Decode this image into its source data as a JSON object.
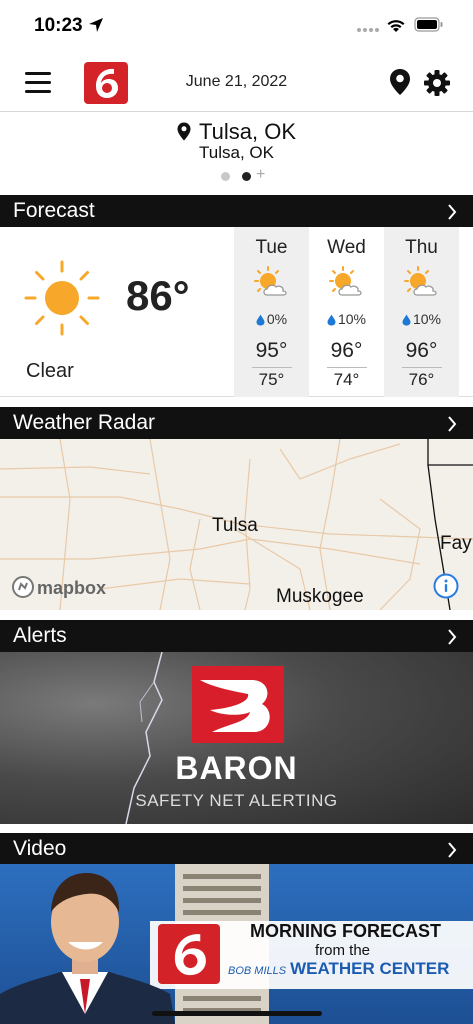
{
  "status_bar": {
    "time": "10:23"
  },
  "header": {
    "date": "June 21, 2022"
  },
  "location": {
    "city": "Tulsa, OK",
    "subtitle": "Tulsa, OK"
  },
  "sections": {
    "forecast": "Forecast",
    "radar": "Weather Radar",
    "alerts": "Alerts",
    "video": "Video"
  },
  "current": {
    "temp": "86°",
    "condition": "Clear",
    "icon": "sun-icon"
  },
  "days": [
    {
      "name": "Tue",
      "precip": "0%",
      "high": "95°",
      "low": "75°",
      "icon": "partly-cloudy-icon"
    },
    {
      "name": "Wed",
      "precip": "10%",
      "high": "96°",
      "low": "74°",
      "icon": "partly-cloudy-icon"
    },
    {
      "name": "Thu",
      "precip": "10%",
      "high": "96°",
      "low": "76°",
      "icon": "partly-cloudy-icon"
    }
  ],
  "radar": {
    "cities": [
      "Tulsa",
      "Muskogee",
      "Fay"
    ],
    "attribution": "mapbox"
  },
  "alerts": {
    "brand": "BARON",
    "tagline": "SAFETY NET ALERTING"
  },
  "video": {
    "line1": "MORNING FORECAST",
    "line2": "from the",
    "line3_small": "BOB MILLS",
    "line3": "WEATHER CENTER"
  },
  "colors": {
    "brand_red": "#d42229",
    "bar_black": "#111111",
    "sun": "#f7a72a",
    "link_blue": "#1c5cb0"
  }
}
